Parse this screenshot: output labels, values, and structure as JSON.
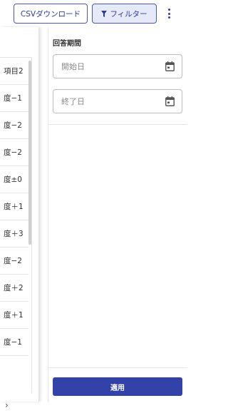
{
  "toolbar": {
    "csv_label": "CSVダウンロード",
    "filter_label": "フィルター"
  },
  "table": {
    "header": "項目2",
    "rows": [
      "度−1",
      "度−2",
      "度−2",
      "度±0",
      "度＋1",
      "度＋3",
      "度−2",
      "度＋2",
      "度＋1",
      "度−1"
    ],
    "next_glyph": "›"
  },
  "filter": {
    "period_label": "回答期間",
    "start_placeholder": "開始日",
    "end_placeholder": "終了日",
    "apply_label": "適用"
  },
  "colors": {
    "primary": "#3342a8",
    "filter_active_bg": "#e6e9f7"
  }
}
